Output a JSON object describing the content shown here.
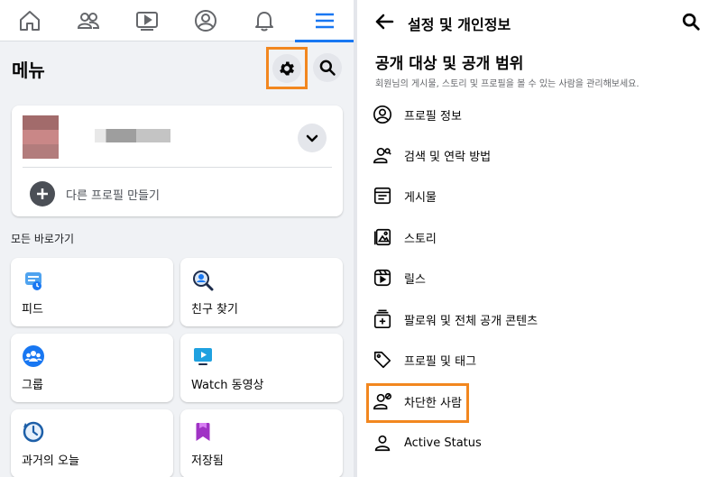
{
  "left": {
    "nav": {
      "items": [
        {
          "name": "home-icon"
        },
        {
          "name": "friends-icon"
        },
        {
          "name": "watch-icon"
        },
        {
          "name": "profile-icon"
        },
        {
          "name": "bell-icon"
        },
        {
          "name": "hamburger-menu-icon",
          "active": true
        }
      ]
    },
    "menu_title": "메뉴",
    "profile_card": {
      "add_profile_label": "다른 프로필 만들기"
    },
    "shortcuts_label": "모든 바로가기",
    "shortcuts": [
      {
        "label": "피드",
        "icon": "feed-icon"
      },
      {
        "label": "친구 찾기",
        "icon": "find-friends-icon"
      },
      {
        "label": "그룹",
        "icon": "groups-icon"
      },
      {
        "label": "Watch 동영상",
        "icon": "watch-video-icon"
      },
      {
        "label": "과거의 오늘",
        "icon": "memories-icon"
      },
      {
        "label": "저장됨",
        "icon": "saved-icon"
      }
    ]
  },
  "right": {
    "title": "설정 및 개인정보",
    "section_title": "공개 대상 및 공개 범위",
    "section_desc": "회원님의 게시물, 스토리 및 프로필을 볼 수 있는 사람을 관리해보세요.",
    "items": [
      {
        "label": "프로필 정보",
        "icon": "profile-info-icon"
      },
      {
        "label": "검색 및 연락 방법",
        "icon": "search-contact-icon"
      },
      {
        "label": "게시물",
        "icon": "posts-icon"
      },
      {
        "label": "스토리",
        "icon": "stories-icon"
      },
      {
        "label": "릴스",
        "icon": "reels-icon"
      },
      {
        "label": "팔로워 및 전체 공개 콘텐츠",
        "icon": "followers-icon"
      },
      {
        "label": "프로필 및 태그",
        "icon": "tag-icon"
      },
      {
        "label": "차단한 사람",
        "icon": "blocked-person-icon"
      },
      {
        "label": "Active Status",
        "icon": "active-status-icon"
      }
    ]
  },
  "colors": {
    "accent": "#1877f2",
    "highlight": "#f2871f",
    "background": "#f0f2f5"
  }
}
